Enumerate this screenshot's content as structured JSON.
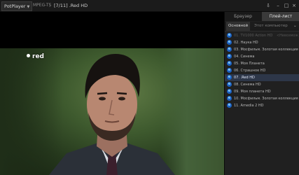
{
  "titlebar": {
    "app_name": "PotPlayer",
    "codec": "MPEG-TS",
    "separator": "|",
    "media_title": "[7/11] .Red HD",
    "buttons": [
      "pin",
      "minimize",
      "maximize",
      "close"
    ]
  },
  "video": {
    "osd_label": "red"
  },
  "panel": {
    "top_tabs": [
      "Браузер",
      "Плей-лист"
    ],
    "active_top_tab": "Плей-лист",
    "sub_tabs": [
      "Основной",
      "Этот компьютер"
    ],
    "active_sub_tab": "Основной",
    "playlist": [
      {
        "label": "01. TV1000 Action HD",
        "extra": "<Невозмож",
        "state": "dim"
      },
      {
        "label": "02. Наука HD",
        "state": "normal"
      },
      {
        "label": "03. Мосфильм. Золотая коллекция",
        "state": "normal"
      },
      {
        "label": "04. Синема",
        "state": "normal"
      },
      {
        "label": "05. Моя Планета",
        "state": "normal"
      },
      {
        "label": "06. Страшное HD",
        "state": "normal"
      },
      {
        "label": "07. .Red HD",
        "state": "current"
      },
      {
        "label": "08. Синема HD",
        "state": "normal"
      },
      {
        "label": "09. Моя планета HD",
        "state": "normal"
      },
      {
        "label": "10. Мосфильм. Золотая коллекция",
        "state": "normal"
      },
      {
        "label": "11. Amedia 2 HD",
        "state": "normal"
      }
    ]
  },
  "icons": {
    "stream": "internet-explorer-icon"
  },
  "colors": {
    "highlight": "#2d3648",
    "panel_bg": "#202020",
    "titlebar_bg": "#1b1b1b"
  }
}
